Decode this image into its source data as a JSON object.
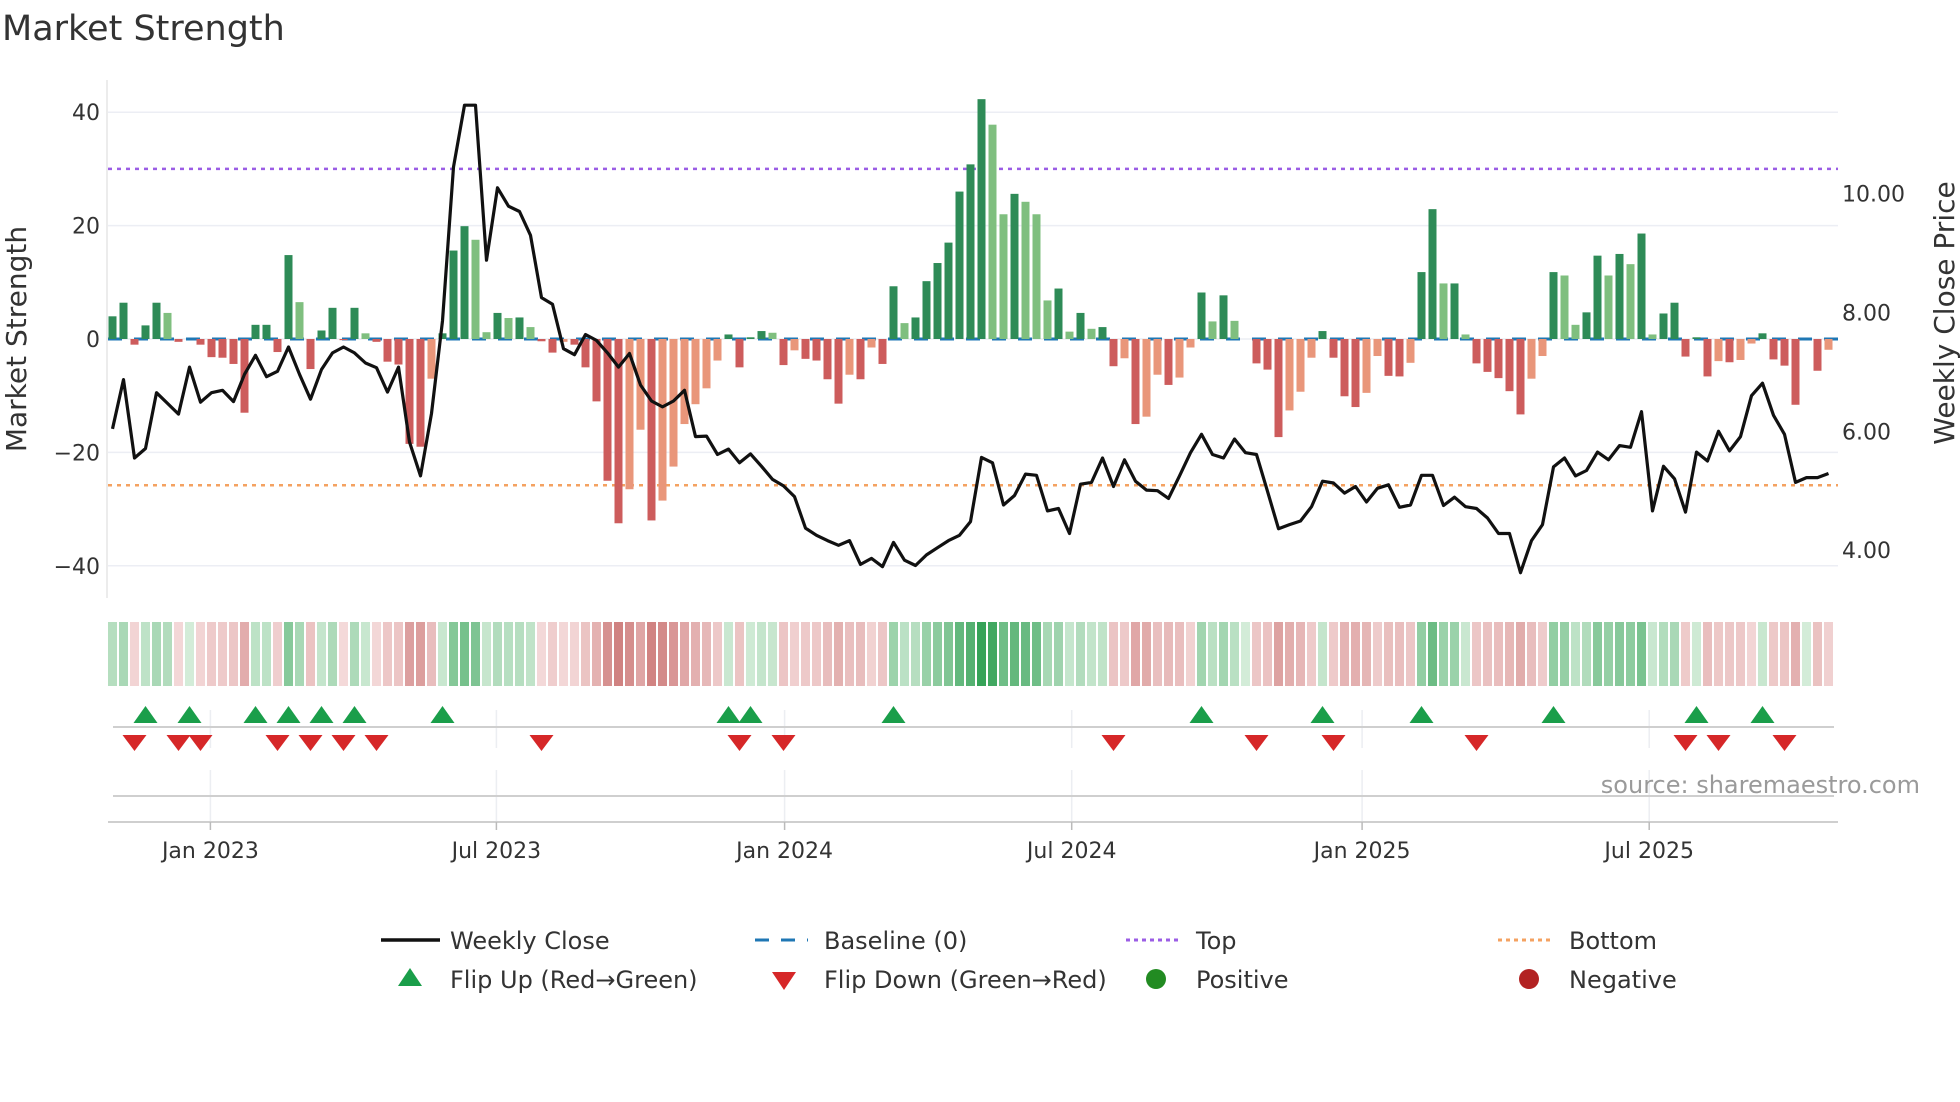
{
  "chart_data": {
    "type": "bar",
    "title": "Market Strength",
    "ylabel": "Market Strength",
    "y2label": "Weekly Close Price",
    "ylim": [
      -46,
      46
    ],
    "y2lim": [
      3.23,
      11.87
    ],
    "yticks": [
      "40",
      "20",
      "0",
      "−20",
      "−40"
    ],
    "ytick_values": [
      40,
      20,
      0,
      -20,
      -40
    ],
    "y2ticks": [
      "10.00",
      "8.00",
      "6.00",
      "4.00"
    ],
    "y2tick_values": [
      10,
      8,
      6,
      4
    ],
    "x_ticks": [
      {
        "label": "Jan 2023",
        "week": 8.9
      },
      {
        "label": "Jul 2023",
        "week": 34.9
      },
      {
        "label": "Jan 2024",
        "week": 61.1
      },
      {
        "label": "Jul 2024",
        "week": 87.2
      },
      {
        "label": "Jan 2025",
        "week": 113.6
      },
      {
        "label": "Jul 2025",
        "week": 139.7
      }
    ],
    "top_level": 30,
    "bottom_level": -25.8,
    "baseline": 0,
    "strength": [
      4,
      6.4,
      -1,
      2.4,
      6.4,
      4.6,
      -0.5,
      0,
      -1,
      -3.2,
      -3.3,
      -4.4,
      -13,
      2.5,
      2.5,
      -2.3,
      14.8,
      6.5,
      -5.3,
      1.5,
      5.5,
      -0.2,
      5.5,
      1,
      -0.5,
      -4,
      -4.5,
      -18.5,
      -19,
      -7,
      1,
      15.6,
      19.9,
      17.5,
      1.2,
      4.6,
      3.7,
      3.8,
      2.1,
      -0.4,
      -2.4,
      -0.5,
      -1,
      -5,
      -11,
      -25,
      -32.5,
      -26.5,
      -16,
      -32,
      -28.5,
      -22.5,
      -15,
      -11.5,
      -8.7,
      -3.8,
      0.8,
      -5,
      0.3,
      1.4,
      1.1,
      -4.6,
      -2,
      -3.5,
      -3.8,
      -7.1,
      -11.4,
      -6.3,
      -7.1,
      -1.5,
      -4.4,
      9.3,
      2.8,
      3.8,
      10.2,
      13.4,
      17,
      26,
      30.8,
      42.3,
      37.8,
      22,
      25.6,
      24.2,
      22,
      6.8,
      8.9,
      1.3,
      4.6,
      1.8,
      2.1,
      -4.8,
      -3.4,
      -15,
      -13.7,
      -6.3,
      -8.1,
      -6.8,
      -1.5,
      8.2,
      3.1,
      7.7,
      3.2,
      0,
      -4.3,
      -5.4,
      -17.3,
      -12.6,
      -9.3,
      -3.3,
      1.4,
      -3.3,
      -10.1,
      -12,
      -9.5,
      -3,
      -6.5,
      -6.6,
      -4.2,
      11.8,
      22.9,
      9.8,
      9.8,
      0.8,
      -4.3,
      -5.8,
      -6.9,
      -9.2,
      -13.3,
      -7,
      -3,
      11.8,
      11.2,
      2.5,
      4.7,
      14.7,
      11.2,
      15,
      13.2,
      18.6,
      0.8,
      4.5,
      6.4,
      -3.1,
      0.3,
      -6.6,
      -3.9,
      -4.1,
      -3.7,
      -0.8,
      1,
      -3.6,
      -4.7,
      -11.6,
      0,
      -5.6,
      -1.9
    ],
    "close": [
      6.04,
      6.87,
      5.55,
      5.71,
      6.65,
      6.47,
      6.29,
      7.08,
      6.49,
      6.65,
      6.69,
      6.5,
      6.96,
      7.28,
      6.92,
      7.01,
      7.42,
      6.96,
      6.54,
      7.04,
      7.32,
      7.42,
      7.32,
      7.15,
      7.07,
      6.66,
      7.08,
      5.82,
      5.25,
      6.3,
      7.86,
      10.45,
      11.49,
      11.49,
      8.88,
      10.1,
      9.79,
      9.7,
      9.3,
      8.25,
      8.14,
      7.39,
      7.29,
      7.63,
      7.53,
      7.32,
      7.08,
      7.31,
      6.78,
      6.51,
      6.41,
      6.51,
      6.69,
      5.91,
      5.92,
      5.61,
      5.7,
      5.47,
      5.62,
      5.41,
      5.19,
      5.08,
      4.9,
      4.37,
      4.25,
      4.16,
      4.08,
      4.16,
      3.76,
      3.86,
      3.72,
      4.13,
      3.83,
      3.74,
      3.92,
      4.04,
      4.16,
      4.25,
      4.48,
      5.56,
      5.47,
      4.76,
      4.92,
      5.28,
      5.26,
      4.66,
      4.7,
      4.28,
      5.11,
      5.14,
      5.55,
      5.07,
      5.52,
      5.16,
      5.01,
      5.0,
      4.87,
      5.25,
      5.64,
      5.95,
      5.61,
      5.55,
      5.87,
      5.64,
      5.61,
      4.99,
      4.36,
      4.43,
      4.49,
      4.73,
      5.16,
      5.13,
      4.96,
      5.07,
      4.81,
      5.04,
      5.1,
      4.72,
      4.76,
      5.26,
      5.26,
      4.75,
      4.89,
      4.73,
      4.7,
      4.54,
      4.28,
      4.28,
      3.62,
      4.16,
      4.43,
      5.4,
      5.55,
      5.25,
      5.34,
      5.65,
      5.52,
      5.76,
      5.73,
      6.33,
      4.66,
      5.41,
      5.2,
      4.64,
      5.65,
      5.5,
      6.0,
      5.67,
      5.91,
      6.6,
      6.81,
      6.27,
      5.95,
      5.14,
      5.22,
      5.22,
      5.29
    ],
    "flip_up": [
      3,
      7,
      13,
      16,
      19,
      22,
      30,
      56,
      58,
      71,
      99,
      110,
      119,
      131,
      144,
      150
    ],
    "flip_down": [
      2,
      6,
      8,
      15,
      18,
      21,
      24,
      39,
      57,
      61,
      91,
      104,
      111,
      124,
      143,
      146,
      152
    ],
    "colors": {
      "pos_strong": "#2e8b57",
      "pos_weak": "#7fbf7f",
      "neg_strong": "#cd5c5c",
      "neg_weak": "#e9967a",
      "baseline": "#1f77b4",
      "top": "#9b5de5",
      "bottom": "#f4a261",
      "close": "#111111",
      "flip_up": "#1a9e4a",
      "flip_down": "#d62728",
      "positive": "#228b22",
      "negative": "#b22222"
    }
  },
  "legend": {
    "weekly_close": "Weekly Close",
    "baseline": "Baseline (0)",
    "top": "Top",
    "bottom": "Bottom",
    "flip_up": "Flip Up (Red→Green)",
    "flip_down": "Flip Down (Green→Red)",
    "positive": "Positive",
    "negative": "Negative"
  },
  "source": "source: sharemaestro.com"
}
